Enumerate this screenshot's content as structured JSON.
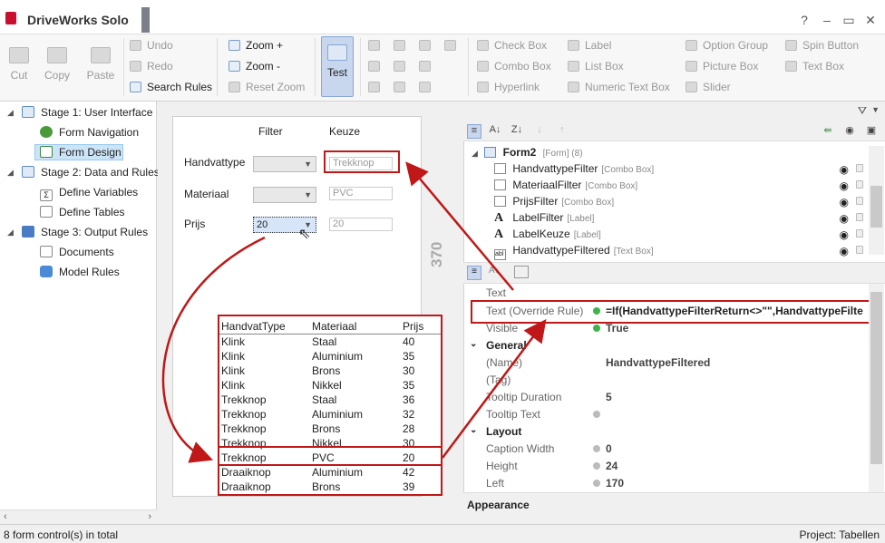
{
  "window": {
    "title": "DriveWorks Solo",
    "help": "?",
    "minimize": "–",
    "maximize": "▭",
    "close": "✕"
  },
  "ribbon": {
    "clipboard": {
      "cut": "Cut",
      "copy": "Copy",
      "paste": "Paste"
    },
    "history": {
      "undo": "Undo",
      "redo": "Redo",
      "search_rules": "Search Rules"
    },
    "zoom": {
      "zoom_in": "Zoom +",
      "zoom_out": "Zoom -",
      "reset": "Reset Zoom"
    },
    "test": "Test",
    "controls": {
      "check_box": "Check Box",
      "label": "Label",
      "option_group": "Option Group",
      "spin_button": "Spin Button",
      "combo_box": "Combo Box",
      "list_box": "List Box",
      "picture_box": "Picture Box",
      "text_box": "Text Box",
      "hyperlink": "Hyperlink",
      "numeric_text_box": "Numeric Text Box",
      "slider": "Slider"
    }
  },
  "tree": {
    "stage1": "Stage 1: User Interface",
    "form_navigation": "Form Navigation",
    "form_design": "Form Design",
    "stage2": "Stage 2: Data and Rules",
    "define_variables": "Define Variables",
    "define_tables": "Define Tables",
    "stage3": "Stage 3: Output Rules",
    "documents": "Documents",
    "model_rules": "Model Rules"
  },
  "form": {
    "header_filter": "Filter",
    "header_keuze": "Keuze",
    "rows": [
      {
        "label": "Handvattype",
        "combo": "",
        "text": "Trekknop"
      },
      {
        "label": "Materiaal",
        "combo": "",
        "text": "PVC"
      },
      {
        "label": "Prijs",
        "combo": "20",
        "text": "20"
      }
    ],
    "height_marker": "370"
  },
  "table": {
    "headers": [
      "HandvatType",
      "Materiaal",
      "Prijs"
    ],
    "rows": [
      [
        "Klink",
        "Staal",
        "40"
      ],
      [
        "Klink",
        "Aluminium",
        "35"
      ],
      [
        "Klink",
        "Brons",
        "30"
      ],
      [
        "Klink",
        "Nikkel",
        "35"
      ],
      [
        "Trekknop",
        "Staal",
        "36"
      ],
      [
        "Trekknop",
        "Aluminium",
        "32"
      ],
      [
        "Trekknop",
        "Brons",
        "28"
      ],
      [
        "Trekknop",
        "Nikkel",
        "30"
      ],
      [
        "Trekknop",
        "PVC",
        "20"
      ],
      [
        "Draaiknop",
        "Aluminium",
        "42"
      ],
      [
        "Draaiknop",
        "Brons",
        "39"
      ]
    ]
  },
  "controls_tree": {
    "root_name": "Form2",
    "root_type": "[Form] (8)",
    "items": [
      {
        "name": "HandvattypeFilter",
        "type": "[Combo Box]"
      },
      {
        "name": "MateriaalFilter",
        "type": "[Combo Box]"
      },
      {
        "name": "PrijsFilter",
        "type": "[Combo Box]"
      },
      {
        "name": "LabelFilter",
        "type": "[Label]"
      },
      {
        "name": "LabelKeuze",
        "type": "[Label]"
      },
      {
        "name": "HandvattypeFiltered",
        "type": "[Text Box]"
      }
    ]
  },
  "properties": {
    "text_label": "Text",
    "override_label": "Text (Override Rule)",
    "override_value": "=If(HandvattypeFilterReturn<>\"\",HandvattypeFilte",
    "visible_label": "Visible",
    "visible_value": "True",
    "general": "General",
    "name_label": "(Name)",
    "name_value": "HandvattypeFiltered",
    "tag_label": "(Tag)",
    "tooltip_duration_label": "Tooltip Duration",
    "tooltip_duration_value": "5",
    "tooltip_text_label": "Tooltip Text",
    "layout": "Layout",
    "caption_width_label": "Caption Width",
    "caption_width_value": "0",
    "height_label": "Height",
    "height_value": "24",
    "left_label": "Left",
    "left_value": "170",
    "appearance": "Appearance"
  },
  "status": {
    "left": "8 form control(s) in total",
    "right": "Project: Tabellen"
  },
  "colors": {
    "highlight_red": "#c01818",
    "selection": "#cce4f7",
    "test_button": "#c8d6ee",
    "rule_dot": "#3fb44a"
  }
}
